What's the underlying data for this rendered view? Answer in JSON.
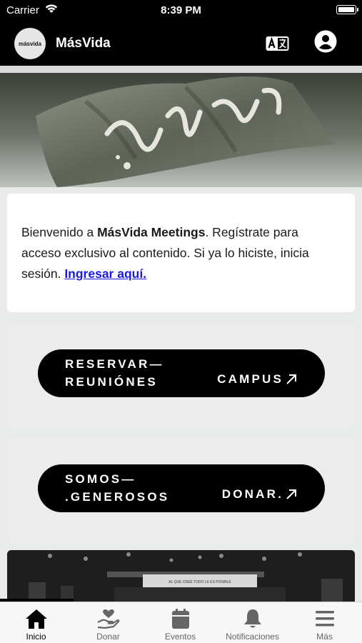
{
  "status_bar": {
    "carrier": "Carrier",
    "time": "8:39 PM"
  },
  "header": {
    "logo_text": "másvida",
    "title": "MásVida"
  },
  "welcome": {
    "prefix": "Bienvenido a ",
    "brand": "MásVida Meetings",
    "body": ". Regístrate para acceso exclusivo al contenido. Si ya lo hiciste, inicia sesión. ",
    "link": "Ingresar aquí."
  },
  "cards": [
    {
      "line1": "RESERVAR—",
      "line2": "REUNIÓNES",
      "action": "CAMPUS"
    },
    {
      "line1": "SOMOS—",
      "line2": ".GENEROSOS",
      "action": "DONAR."
    }
  ],
  "photo": {
    "sign_text": "AL QUE CREE TODO LE ES POSIBLE"
  },
  "tabs": [
    {
      "label": "Inicio",
      "icon": "home-icon",
      "active": true
    },
    {
      "label": "Donar",
      "icon": "donate-hand-heart-icon",
      "active": false
    },
    {
      "label": "Eventos",
      "icon": "calendar-icon",
      "active": false
    },
    {
      "label": "Notificaciones",
      "icon": "bell-icon",
      "active": false
    },
    {
      "label": "Más",
      "icon": "menu-icon",
      "active": false
    }
  ]
}
